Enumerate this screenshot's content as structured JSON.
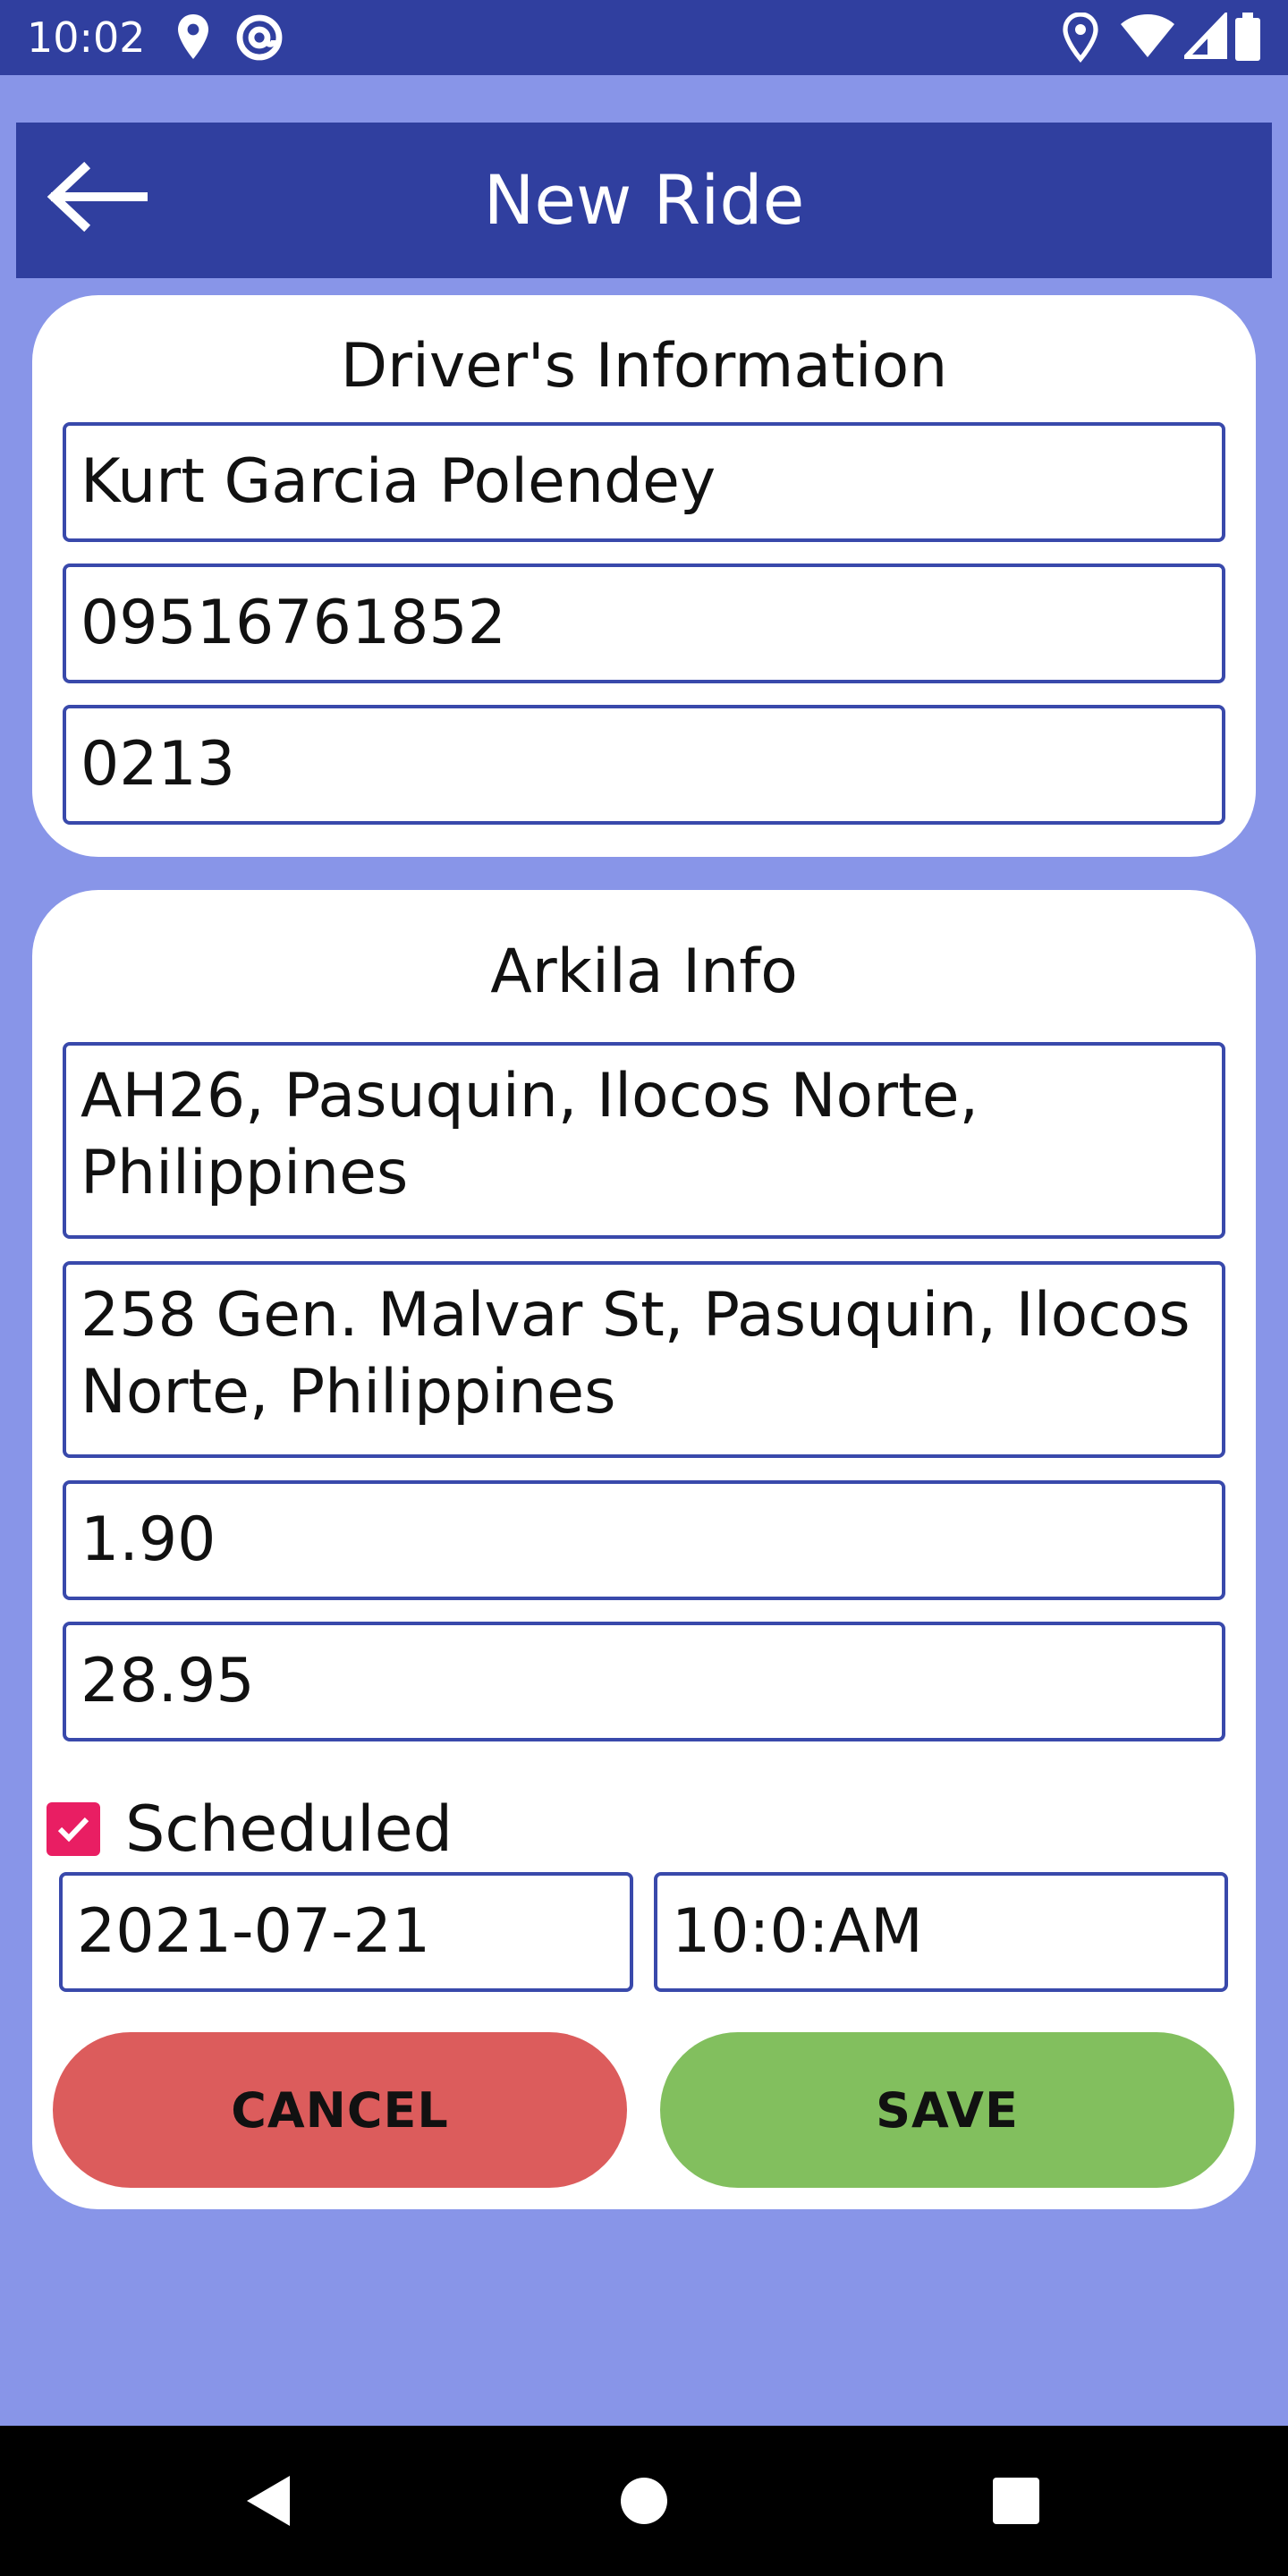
{
  "status_bar": {
    "time": "10:02",
    "left_icons": [
      "location-icon",
      "at-sign-icon"
    ],
    "right_icons": [
      "location-icon",
      "wifi-icon",
      "signal-icon",
      "battery-icon"
    ]
  },
  "app_bar": {
    "title": "New Ride",
    "back_icon": "arrow-left-icon"
  },
  "driver_card": {
    "title": "Driver's Information",
    "name": "Kurt Garcia Polendey",
    "phone": "09516761852",
    "code": "0213"
  },
  "arkila_card": {
    "title": "Arkila Info",
    "pickup": "AH26, Pasuquin, Ilocos Norte, Philippines",
    "dropoff": "258 Gen. Malvar St, Pasuquin, Ilocos Norte, Philippines",
    "distance": "1.90",
    "fare": "28.95",
    "scheduled_label": "Scheduled",
    "scheduled_checked": true,
    "date": "2021-07-21",
    "time": "10:0:AM",
    "cancel_label": "CANCEL",
    "save_label": "SAVE"
  },
  "colors": {
    "primary": "#303f9f",
    "background": "#8895e8",
    "field_border": "#3949ab",
    "checkbox": "#e91e63",
    "cancel": "#dc5c5c",
    "save": "#82bf5e"
  },
  "nav_bar": {
    "icons": [
      "back-triangle-icon",
      "home-circle-icon",
      "recents-square-icon"
    ]
  }
}
